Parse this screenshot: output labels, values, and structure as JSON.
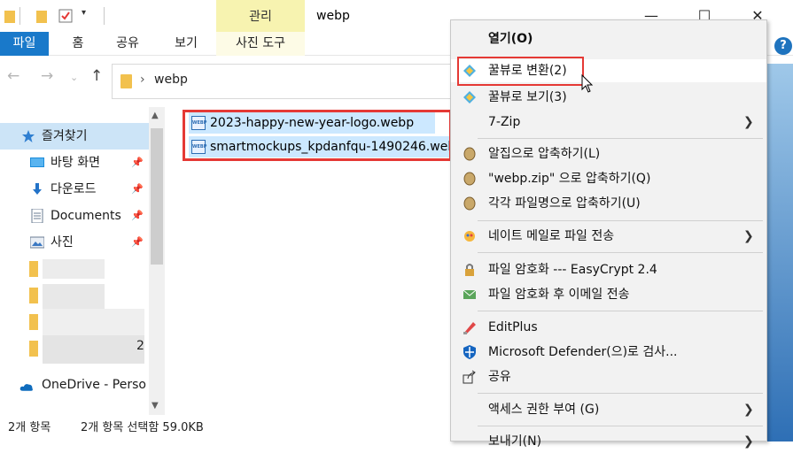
{
  "window": {
    "title": "webp",
    "manage_tab": "관리",
    "controls": {
      "minimize": "—",
      "maximize": "☐",
      "close": "✕"
    }
  },
  "ribbon": {
    "tabs": [
      "파일",
      "홈",
      "공유",
      "보기",
      "사진 도구"
    ],
    "help": "?"
  },
  "address": {
    "path": "webp"
  },
  "nav": {
    "quick_access": "즐겨찾기",
    "pinned": [
      {
        "label": "바탕 화면",
        "icon": "desktop-icon"
      },
      {
        "label": "다운로드",
        "icon": "download-icon"
      },
      {
        "label": "Documents",
        "icon": "documents-icon"
      },
      {
        "label": "사진",
        "icon": "pictures-icon"
      }
    ],
    "onedrive": "OneDrive - Perso",
    "blurred_suffix": "2"
  },
  "files": [
    {
      "name": "2023-happy-new-year-logo.webp",
      "icon": "webp-file-icon"
    },
    {
      "name": "smartmockups_kpdanfqu-1490246.webp",
      "icon": "webp-file-icon"
    }
  ],
  "status": {
    "count": "2개 항목",
    "selected": "2개 항목 선택함 59.0KB"
  },
  "context_menu": {
    "items": [
      {
        "label": "열기(O)",
        "bold": true
      },
      {
        "label": "꿀뷰로 변환(2)",
        "icon": "honeyview-icon",
        "highlight": true
      },
      {
        "label": "꿀뷰로 보기(3)",
        "icon": "honeyview-icon"
      },
      {
        "label": "7-Zip",
        "submenu": true
      },
      {
        "label": "알집으로 압축하기(L)",
        "icon": "alzip-icon"
      },
      {
        "label": "\"webp.zip\" 으로 압축하기(Q)",
        "icon": "alzip-icon"
      },
      {
        "label": "각각 파일명으로 압축하기(U)",
        "icon": "alzip-icon"
      },
      {
        "label": "네이트 메일로 파일 전송",
        "icon": "nate-mail-icon",
        "submenu": true
      },
      {
        "label": "파일 암호화 --- EasyCrypt 2.4",
        "icon": "lock-icon"
      },
      {
        "label": "파일 암호화 후 이메일 전송",
        "icon": "encrypt-mail-icon"
      },
      {
        "label": "EditPlus",
        "icon": "editplus-icon"
      },
      {
        "label": "Microsoft Defender(으)로 검사...",
        "icon": "defender-shield-icon"
      },
      {
        "label": "공유",
        "icon": "share-icon"
      },
      {
        "label": "액세스 권한 부여 (G)",
        "submenu": true
      },
      {
        "label": "보내기(N)",
        "submenu": true
      }
    ]
  },
  "colors": {
    "file_tab": "#1979ca",
    "manage_tab": "#f7f3b0",
    "selection": "#cce8ff",
    "highlight_box": "#e53935"
  }
}
